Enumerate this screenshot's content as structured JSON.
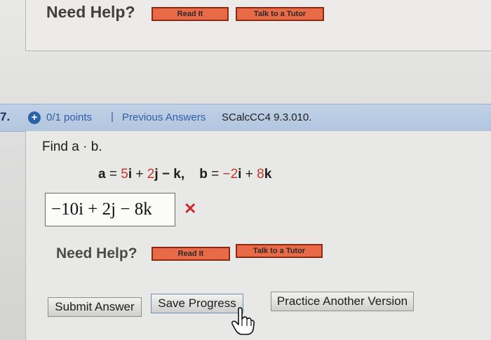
{
  "previous_question": {
    "need_help": "Need Help?",
    "read_it": "Read It",
    "talk_to_tutor": "Talk to a Tutor"
  },
  "question": {
    "number": "7.",
    "points": "0/1 points",
    "separator": "|",
    "previous_answers": "Previous Answers",
    "code": "SCalcCC4 9.3.010.",
    "prompt": "Find a · b.",
    "vectors": {
      "a_label": "a",
      "eq": " = ",
      "a_c1": "5",
      "i": "i",
      "plus": " + ",
      "a_c2": "2",
      "j": "j",
      "minus_k": " − k,",
      "spacer": "    ",
      "b_label": "b",
      "b_c1": "−2",
      "b_plus": " + ",
      "b_c2": "8",
      "k": "k"
    },
    "answer_value": "−10i + 2j − 8k",
    "wrong_mark": "✕",
    "need_help": "Need Help?",
    "read_it": "Read It",
    "talk_to_tutor": "Talk to a Tutor"
  },
  "actions": {
    "submit": "Submit Answer",
    "save": "Save Progress",
    "practice": "Practice Another Version"
  },
  "icons": {
    "plus": "plus-circle-icon",
    "wrong": "x-mark-icon",
    "cursor": "hand-pointer-icon"
  },
  "colors": {
    "header_bar": "#b3c6df",
    "link_blue": "#2f5ea5",
    "help_button_red": "#e86a47",
    "wrong_red": "#cc2b2b"
  }
}
